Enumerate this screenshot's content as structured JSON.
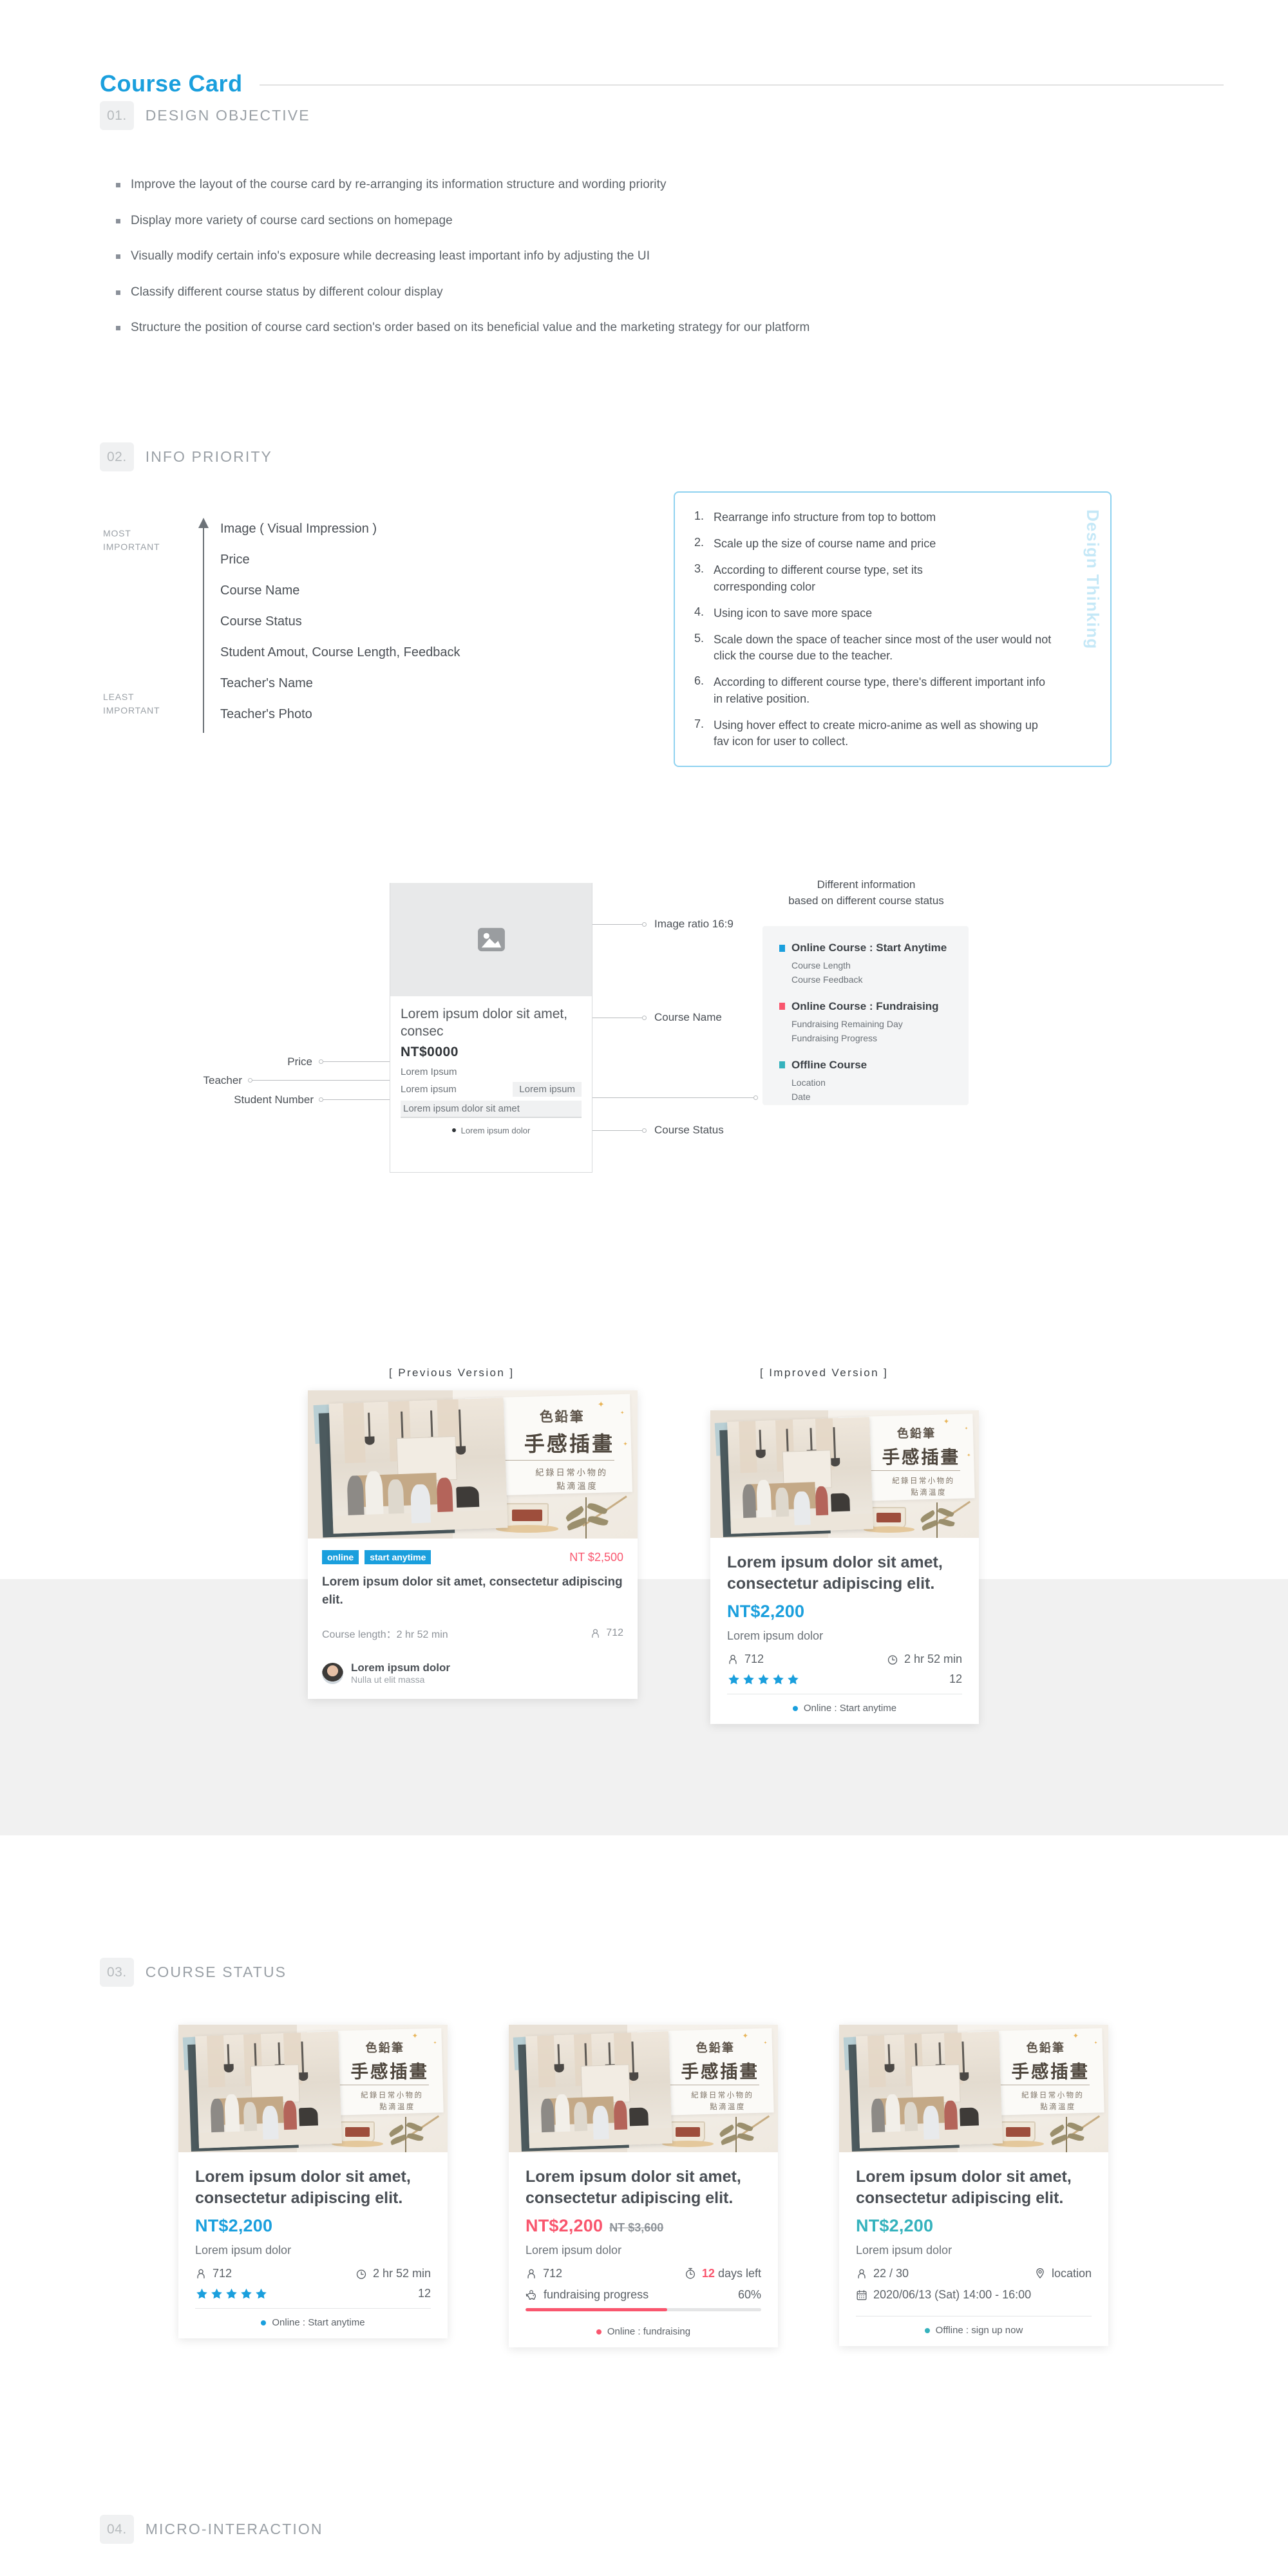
{
  "header": {
    "title": "Course Card"
  },
  "sections": {
    "s1": {
      "num": "01.",
      "label": "DESIGN OBJECTIVE"
    },
    "s2": {
      "num": "02.",
      "label": "INFO PRIORITY"
    },
    "s3": {
      "num": "03.",
      "label": "COURSE STATUS"
    },
    "s4": {
      "num": "04.",
      "label": "MICRO-INTERACTION"
    }
  },
  "objectives": [
    "Improve the layout of the course card by re-arranging its information structure and wording priority",
    "Display more variety of course card sections on homepage",
    "Visually modify certain info's exposure while decreasing least important info by adjusting the UI",
    "Classify different course status by different colour display",
    "Structure the position of course card section's order based on its beneficial value and the marketing strategy for our platform"
  ],
  "info_priority": {
    "most_label": "MOST\nIMPORTANT",
    "most_line1": "MOST",
    "most_line2": "IMPORTANT",
    "least_line1": "LEAST",
    "least_line2": "IMPORTANT",
    "items": [
      "Image ( Visual Impression )",
      "Price",
      "Course Name",
      "Course Status",
      "Student Amout, Course Length, Feedback",
      "Teacher's Name",
      "Teacher's Photo"
    ]
  },
  "design_thinking": {
    "vertical_label": "Design Thinking",
    "items": [
      {
        "num": "1.",
        "text": "Rearrange info structure from top to bottom"
      },
      {
        "num": "2.",
        "text": "Scale up the size of course name and price"
      },
      {
        "num": "3.",
        "text": "According to different course type, set its corresponding color"
      },
      {
        "num": "4.",
        "text": "Using icon to save more space"
      },
      {
        "num": "5.",
        "text": "Scale down the space of teacher since most of the user would not click the course due to the teacher."
      },
      {
        "num": "6.",
        "text": "According to different course type, there's different important info in relative position."
      },
      {
        "num": "7.",
        "text": "Using hover effect to create micro-anime as well as showing up fav icon for user to collect."
      }
    ]
  },
  "wireframe": {
    "card": {
      "name": "Lorem ipsum dolor sit amet, consec",
      "price": "NT$0000",
      "teacher": "Lorem Ipsum",
      "student_left": "Lorem ipsum",
      "student_chip": "Lorem ipsum",
      "bar": "Lorem ipsum dolor sit amet",
      "status": "Lorem ipsum dolor"
    },
    "left_labels": {
      "price": "Price",
      "teacher": "Teacher",
      "student": "Student Number"
    },
    "right_labels": {
      "image": "Image ratio 16:9",
      "name": "Course Name",
      "status": "Course Status"
    },
    "legend": {
      "title_line1": "Different information",
      "title_line2": "based on different course status",
      "groups": [
        {
          "color": "#1a9fdd",
          "title": "Online Course : Start Anytime",
          "subs": [
            "Course Length",
            "Course Feedback"
          ]
        },
        {
          "color": "#f9566e",
          "title": "Online Course : Fundraising",
          "subs": [
            "Fundraising Remaining Day",
            "Fundraising Progress"
          ]
        },
        {
          "color": "#35b2bd",
          "title": "Offline Course",
          "subs": [
            "Location",
            "Date"
          ]
        }
      ]
    }
  },
  "comparison": {
    "previous_label": "[ Previous Version ]",
    "improved_label": "[ Improved Version ]",
    "previous": {
      "tag_online": "online",
      "tag_anytime": "start anytime",
      "price": "NT $2,500",
      "title": "Lorem ipsum dolor sit amet, consectetur adipiscing elit.",
      "length_label": "Course length：2 hr 52 min",
      "students": "712",
      "teacher_name": "Lorem ipsum dolor",
      "teacher_sub": "Nulla ut elit massa",
      "photo": {
        "cn_top": "色鉛筆",
        "cn_main": "手感插畫",
        "cn_sub1": "紀錄日常小物的",
        "cn_sub2": "點滴溫度"
      }
    },
    "improved": {
      "title": "Lorem ipsum dolor sit amet, consectetur adipiscing elit.",
      "price": "NT$2,200",
      "price_color": "#1a9fdd",
      "teacher": "Lorem ipsum dolor",
      "students": "712",
      "length": "2 hr 52 min",
      "stars": 5,
      "reviews": "12",
      "status": "Online : Start anytime",
      "status_color": "#1a9fdd",
      "photo": {
        "cn_top": "色鉛筆",
        "cn_main": "手感插畫",
        "cn_sub1": "紀錄日常小物的",
        "cn_sub2": "點滴溫度"
      }
    }
  },
  "status_cards": [
    {
      "id": "online-anytime",
      "title": "Lorem ipsum dolor sit amet, consectetur adipiscing elit.",
      "price": "NT$2,200",
      "price_color": "#1a9fdd",
      "old_price": "",
      "teacher": "Lorem ipsum dolor",
      "students": "712",
      "right_meta": "2 hr 52 min",
      "right_icon": "clock-icon",
      "stars": 5,
      "reviews": "12",
      "progress_label": "",
      "progress_value": "",
      "progress_pct": 0,
      "status": "Online : Start anytime",
      "status_color": "#1a9fdd",
      "photo": {
        "cn_top": "色鉛筆",
        "cn_main": "手感插畫",
        "cn_sub1": "紀錄日常小物的",
        "cn_sub2": "點滴溫度"
      }
    },
    {
      "id": "online-fundraising",
      "title": "Lorem ipsum dolor sit amet, consectetur adipiscing elit.",
      "price": "NT$2,200",
      "price_color": "#f9566e",
      "old_price": "NT $3,600",
      "teacher": "Lorem ipsum dolor",
      "students": "712",
      "right_meta": "12 days left",
      "right_meta_num": "12",
      "right_meta_rest": "days left",
      "right_icon": "timer-icon",
      "stars": 0,
      "reviews": "",
      "progress_label": "fundraising progress",
      "progress_value": "60%",
      "progress_pct": 60,
      "status": "Online : fundraising",
      "status_color": "#f9566e",
      "photo": {
        "cn_top": "色鉛筆",
        "cn_main": "手感插畫",
        "cn_sub1": "紀錄日常小物的",
        "cn_sub2": "點滴溫度"
      }
    },
    {
      "id": "offline",
      "title": "Lorem ipsum dolor sit amet, consectetur adipiscing elit.",
      "price": "NT$2,200",
      "price_color": "#35b2bd",
      "old_price": "",
      "teacher": "Lorem ipsum dolor",
      "students": "22 / 30",
      "right_meta": "location",
      "right_icon": "pin-icon",
      "stars": 0,
      "reviews": "",
      "date_line": "2020/06/13 (Sat) 14:00 - 16:00",
      "progress_label": "",
      "progress_value": "",
      "progress_pct": 0,
      "status": "Offline : sign up now",
      "status_color": "#35b2bd",
      "photo": {
        "cn_top": "色鉛筆",
        "cn_main": "手感插畫",
        "cn_sub1": "紀錄日常小物的",
        "cn_sub2": "點滴溫度"
      }
    }
  ],
  "colors": {
    "brand_blue": "#1a9fdd",
    "pink": "#f9566e",
    "teal": "#35b2bd",
    "grey_band": "#f1f1f1",
    "text": "#4a4f55"
  }
}
